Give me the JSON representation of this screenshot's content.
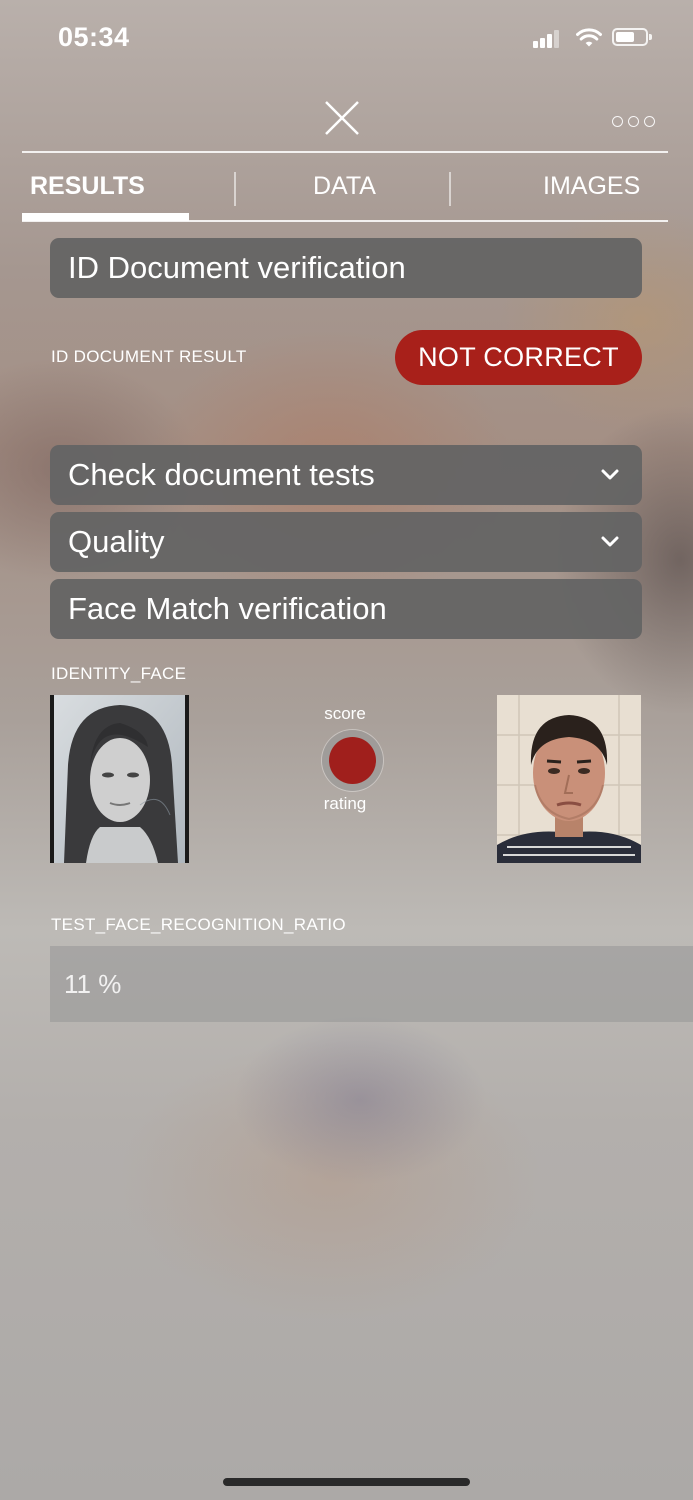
{
  "status_bar": {
    "time": "05:34",
    "signal_icon": "cellular-signal-icon",
    "wifi_icon": "wifi-icon",
    "battery_icon": "battery-icon"
  },
  "header": {
    "close_icon": "close-x-icon",
    "more_icon": "more-options-dots-icon"
  },
  "tabs": [
    {
      "label": "RESULTS",
      "active": true
    },
    {
      "label": "DATA",
      "active": false
    },
    {
      "label": "IMAGES",
      "active": false
    }
  ],
  "sections": {
    "id_document": {
      "title": "ID Document verification"
    },
    "result": {
      "label": "ID DOCUMENT RESULT",
      "value": "NOT CORRECT",
      "color": "#a8201a"
    },
    "check_tests": {
      "title": "Check document tests",
      "icon": "chevron-down-icon"
    },
    "quality": {
      "title": "Quality",
      "icon": "chevron-down-icon"
    },
    "face_match": {
      "title": "Face Match verification"
    },
    "identity_face": {
      "label": "IDENTITY_FACE",
      "score_label": "score",
      "rating_label": "rating",
      "rating_color": "#a01f1c"
    },
    "ratio": {
      "label": "TEST_FACE_RECOGNITION_RATIO",
      "value": "11 %"
    }
  }
}
